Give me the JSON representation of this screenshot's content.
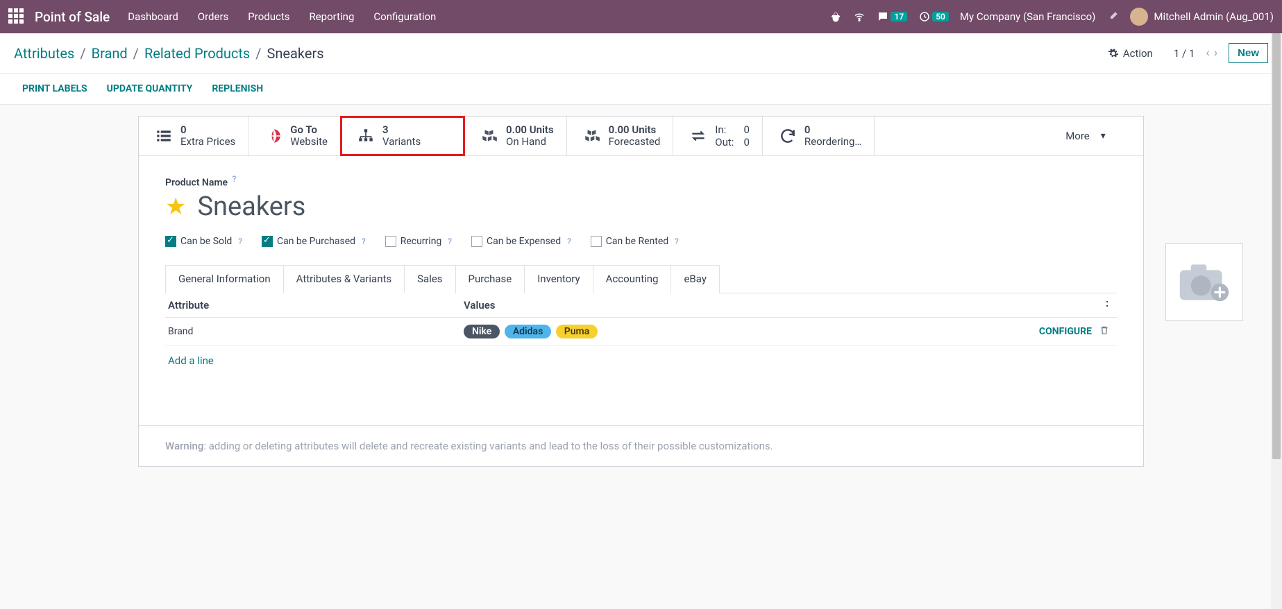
{
  "nav": {
    "brand": "Point of Sale",
    "items": [
      "Dashboard",
      "Orders",
      "Products",
      "Reporting",
      "Configuration"
    ],
    "chat_badge": "17",
    "clock_badge": "50",
    "company": "My Company (San Francisco)",
    "user": "Mitchell Admin (Aug_001)"
  },
  "breadcrumb": {
    "parts": [
      "Attributes",
      "Brand",
      "Related Products"
    ],
    "current": "Sneakers",
    "action_label": "Action",
    "pager": "1 / 1",
    "new_label": "New"
  },
  "action_buttons": [
    "PRINT LABELS",
    "UPDATE QUANTITY",
    "REPLENISH"
  ],
  "stats": {
    "extra_prices": {
      "n": "0",
      "label": "Extra Prices"
    },
    "website": {
      "label_top": "Go To",
      "label": "Website"
    },
    "variants": {
      "n": "3",
      "label": "Variants"
    },
    "onhand": {
      "n": "0.00",
      "unit": "Units",
      "label": "On Hand"
    },
    "forecast": {
      "n": "0.00",
      "unit": "Units",
      "label": "Forecasted"
    },
    "in_label": "In:",
    "in_n": "0",
    "out_label": "Out:",
    "out_n": "0",
    "reorder": {
      "n": "0",
      "label": "Reordering…"
    },
    "more": "More"
  },
  "product": {
    "name_label": "Product Name",
    "name": "Sneakers",
    "options": {
      "sold": "Can be Sold",
      "purchased": "Can be Purchased",
      "recurring": "Recurring",
      "expensed": "Can be Expensed",
      "rented": "Can be Rented"
    }
  },
  "tabs": [
    "General Information",
    "Attributes & Variants",
    "Sales",
    "Purchase",
    "Inventory",
    "Accounting",
    "eBay"
  ],
  "active_tab_index": 1,
  "table": {
    "head_attr": "Attribute",
    "head_val": "Values",
    "row": {
      "attr": "Brand",
      "tags": [
        "Nike",
        "Adidas",
        "Puma"
      ],
      "configure": "CONFIGURE"
    },
    "add_line": "Add a line"
  },
  "warning_label": "Warning",
  "warning_text": ": adding or deleting attributes will delete and recreate existing variants and lead to the loss of their possible customizations."
}
